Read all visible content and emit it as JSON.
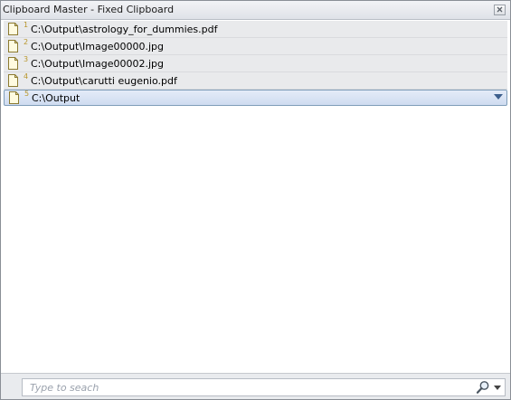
{
  "window": {
    "title": "Clipboard Master - Fixed Clipboard"
  },
  "list": {
    "items": [
      {
        "number": "1",
        "path": "C:\\Output\\astrology_for_dummies.pdf"
      },
      {
        "number": "2",
        "path": "C:\\Output\\Image00000.jpg"
      },
      {
        "number": "3",
        "path": "C:\\Output\\Image00002.jpg"
      },
      {
        "number": "4",
        "path": "C:\\Output\\carutti eugenio.pdf"
      },
      {
        "number": "5",
        "path": "C:\\Output",
        "selected": true
      }
    ]
  },
  "search": {
    "placeholder": "Type to seach",
    "value": ""
  },
  "icons": {
    "file": "file-icon",
    "close": "close-icon",
    "search": "magnifier-icon",
    "dropdown": "chevron-down-icon"
  },
  "colors": {
    "number": "#b8962a",
    "selection_border": "#7f9db9",
    "accent": "#3d5f8c"
  }
}
